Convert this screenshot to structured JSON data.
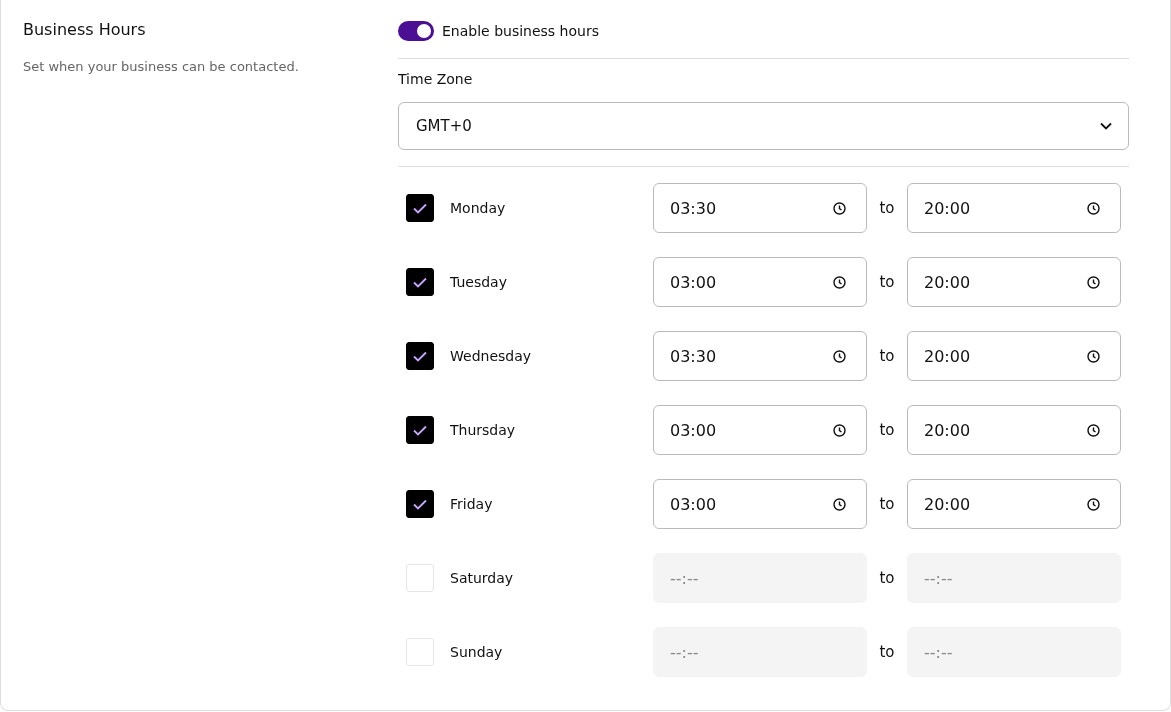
{
  "section": {
    "title": "Business Hours",
    "description": "Set when your business can be contacted."
  },
  "enable_toggle": {
    "label": "Enable business hours",
    "on": true
  },
  "time_zone": {
    "label": "Time Zone",
    "value": "GMT+0"
  },
  "days": [
    {
      "name": "Monday",
      "checked": true,
      "start": "03:30",
      "separator": "to",
      "end": "20:00"
    },
    {
      "name": "Tuesday",
      "checked": true,
      "start": "03:00",
      "separator": "to",
      "end": "20:00"
    },
    {
      "name": "Wednesday",
      "checked": true,
      "start": "03:30",
      "separator": "to",
      "end": "20:00"
    },
    {
      "name": "Thursday",
      "checked": true,
      "start": "03:00",
      "separator": "to",
      "end": "20:00"
    },
    {
      "name": "Friday",
      "checked": true,
      "start": "03:00",
      "separator": "to",
      "end": "20:00"
    },
    {
      "name": "Saturday",
      "checked": false,
      "start": "--:--",
      "separator": "to",
      "end": "--:--"
    },
    {
      "name": "Sunday",
      "checked": false,
      "start": "--:--",
      "separator": "to",
      "end": "--:--"
    }
  ]
}
